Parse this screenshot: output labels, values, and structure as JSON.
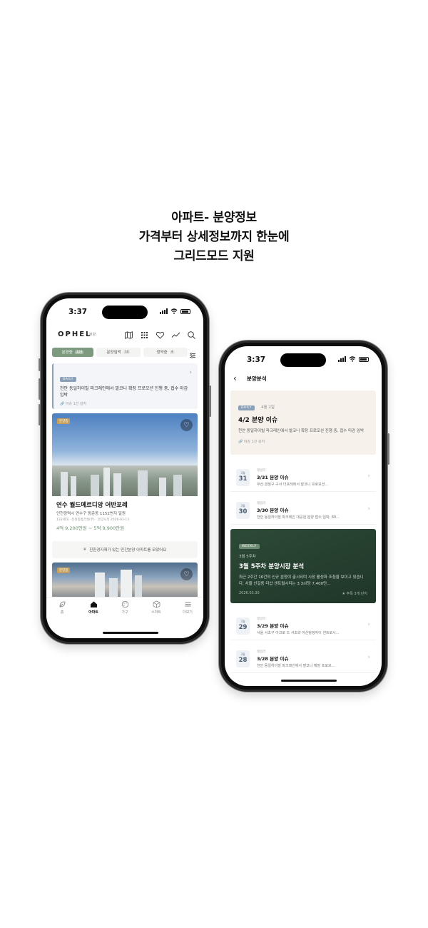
{
  "headline": {
    "line1": "아파트- 분양정보",
    "line2": "가격부터 상세정보까지 한눈에",
    "line3": "그리드모드 지원"
  },
  "phone1": {
    "status": {
      "time": "3:37"
    },
    "header": {
      "logo": "OPHEL",
      "logo_sub": "분양"
    },
    "tabs": [
      {
        "label": "분양중",
        "count": "120"
      },
      {
        "label": "분양임박",
        "count": "10"
      },
      {
        "label": "청약중",
        "count": "4"
      }
    ],
    "daily": {
      "badge": "DAILY",
      "text": "천안 동일하이빌 파크레인에서 발코니 확장 프로모션 진행 중, 접수 마감 임박",
      "meta": "이슈 1건 감지"
    },
    "listings": [
      {
        "tag": "분양중",
        "name": "연수 월드메르디앙 어반포레",
        "address": "인천광역시 연수구 동춘동 1152번지 일원",
        "meta": "133세대 · 신성종합건설(주) · 분양시작 2026-03-13",
        "price": "4억 9,200만원 ~ 5억 9,900만원"
      },
      {
        "tag": "분양중"
      }
    ],
    "eco_banner": "친환경자재가 있는 민간분양 아파트를 모았어요",
    "nav": [
      {
        "label": "홈",
        "icon": "leaf-icon"
      },
      {
        "label": "아파트",
        "icon": "house-icon"
      },
      {
        "label": "가구",
        "icon": "palette-icon"
      },
      {
        "label": "스마트",
        "icon": "cube-icon"
      },
      {
        "label": "더보기",
        "icon": "menu-icon"
      }
    ]
  },
  "phone2": {
    "status": {
      "time": "3:37"
    },
    "header": {
      "title": "분양분석"
    },
    "hero": {
      "badge": "DAILY",
      "date": "4월 2일",
      "title": "4/2 분양 이슈",
      "text": "천안 동일하이빌 파크레인에서 발코니 확장 프로모션 진행 중, 접수 마감 임박",
      "meta": "이슈 1건 감지"
    },
    "issues": [
      {
        "month": "3월",
        "day": "31",
        "label": "데일리",
        "title": "3/31 분양 이슈",
        "sub": "부산 금정구 구서 더포레에서 발코니 프로모션..."
      },
      {
        "month": "3월",
        "day": "30",
        "label": "데일리",
        "title": "3/30 분양 이슈",
        "sub": "천안 동일하이빌 파크레인 대공원 분양 접수 임박, 89..."
      }
    ],
    "weekly": {
      "badge": "WEEKLY",
      "sub": "3월 5주차",
      "title": "3월 5주차 분양시장 분석",
      "text": "최근 2주간 16건의 신규 분양이 출시되며 시장 활성화 조짐을 보이고 있습니다. 서울 신길동 더샵 센트럴시티는 3.3㎡당 7,400만...",
      "date": "2026.03.30",
      "meta": "주목 3개 단지"
    },
    "issues_after": [
      {
        "month": "3월",
        "day": "29",
        "label": "데일리",
        "title": "3/29 분양 이슈",
        "sub": "서울 서초구 아크로 드 서초와 아산탕정자이 센트로시..."
      },
      {
        "month": "3월",
        "day": "28",
        "label": "데일리",
        "title": "3/28 분양 이슈",
        "sub": "천안 동일하이빌 파크레인에서 발코니 확장 프로모..."
      }
    ]
  }
}
